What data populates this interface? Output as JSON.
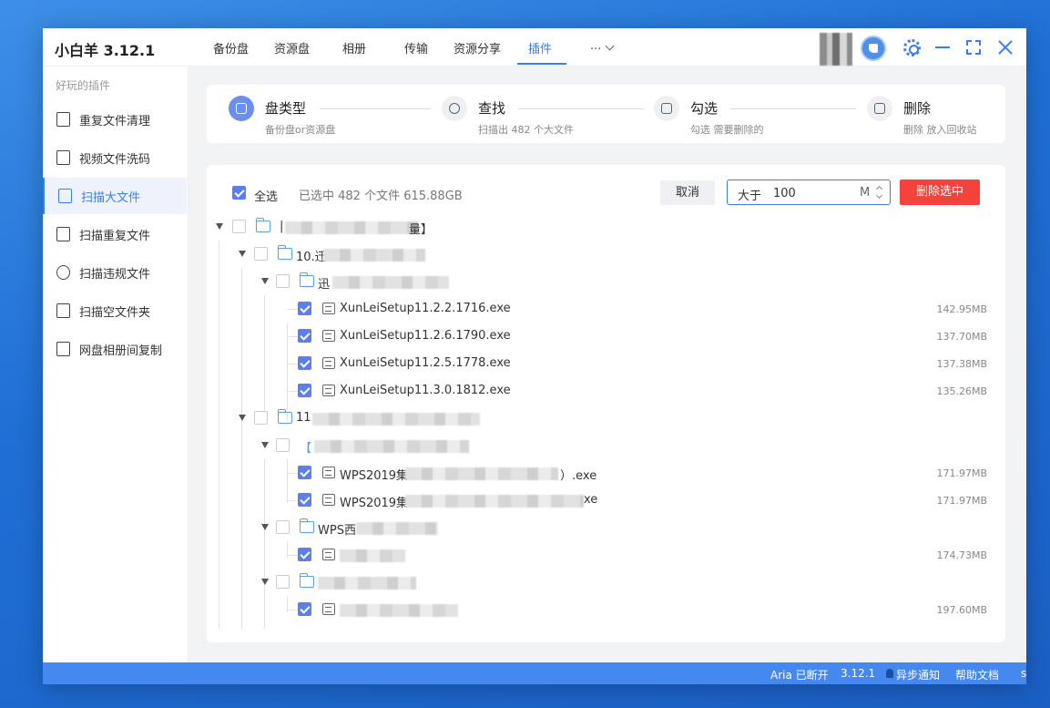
{
  "app": {
    "title": "小白羊 3.12.1"
  },
  "tabs": [
    {
      "label": "备份盘"
    },
    {
      "label": "资源盘"
    },
    {
      "label": "相册"
    },
    {
      "label": "传输"
    },
    {
      "label": "资源分享"
    },
    {
      "label": "插件",
      "active": true
    }
  ],
  "more_tabs_label": "...",
  "sidebar": {
    "heading": "好玩的插件",
    "items": [
      {
        "label": "重复文件清理",
        "icon": "duplicate-file-icon"
      },
      {
        "label": "视频文件洗码",
        "icon": "video-file-icon"
      },
      {
        "label": "扫描大文件",
        "icon": "large-file-icon",
        "active": true
      },
      {
        "label": "扫描重复文件",
        "icon": "duplicate-scan-icon"
      },
      {
        "label": "扫描违规文件",
        "icon": "violation-icon"
      },
      {
        "label": "扫描空文件夹",
        "icon": "empty-folder-icon"
      },
      {
        "label": "网盘相册间复制",
        "icon": "copy-icon"
      }
    ]
  },
  "steps": [
    {
      "title": "盘类型",
      "desc": "备份盘or资源盘",
      "active": true
    },
    {
      "title": "查找",
      "desc": "扫描出 482 个大文件"
    },
    {
      "title": "勾选",
      "desc": "勾选 需要删除的"
    },
    {
      "title": "删除",
      "desc": "删除 放入回收站"
    }
  ],
  "toolbar": {
    "select_all_label": "全选",
    "selected_summary": "已选中 482 个文件 615.88GB",
    "cancel_label": "取消",
    "size_prefix": "大于",
    "size_value": "100",
    "size_unit": "M",
    "delete_label": "删除选中"
  },
  "tree": [
    {
      "label": "|",
      "suffix": "量】",
      "type": "folder",
      "checked": false
    },
    {
      "label": "10.迁",
      "type": "folder",
      "checked": false
    },
    {
      "label": "迅",
      "type": "folder",
      "checked": false
    },
    {
      "label": "XunLeiSetup11.2.2.1716.exe",
      "type": "file",
      "checked": true,
      "size": "142.95MB"
    },
    {
      "label": "XunLeiSetup11.2.6.1790.exe",
      "type": "file",
      "checked": true,
      "size": "137.70MB"
    },
    {
      "label": "XunLeiSetup11.2.5.1778.exe",
      "type": "file",
      "checked": true,
      "size": "137.38MB"
    },
    {
      "label": "XunLeiSetup11.3.0.1812.exe",
      "type": "file",
      "checked": true,
      "size": "135.26MB"
    },
    {
      "label": "11",
      "type": "folder",
      "checked": false
    },
    {
      "label": "【",
      "type": "folder",
      "checked": false
    },
    {
      "label": "WPS2019集",
      "suffix": "）.exe",
      "type": "file",
      "checked": true,
      "size": "171.97MB"
    },
    {
      "label": "WPS2019集",
      "suffix": "xe",
      "type": "file",
      "checked": true,
      "size": "171.97MB"
    },
    {
      "label": "WPS西",
      "type": "folder",
      "checked": false
    },
    {
      "label": "",
      "type": "file",
      "checked": true,
      "size": "174.73MB"
    },
    {
      "label": "",
      "type": "folder",
      "checked": false
    },
    {
      "label": "",
      "type": "file",
      "checked": true,
      "size": "197.60MB"
    }
  ],
  "statusbar": {
    "aria": "Aria 已断开",
    "version": "3.12.1",
    "sync": "异步通知",
    "help": "帮助文档",
    "extra": "s"
  }
}
